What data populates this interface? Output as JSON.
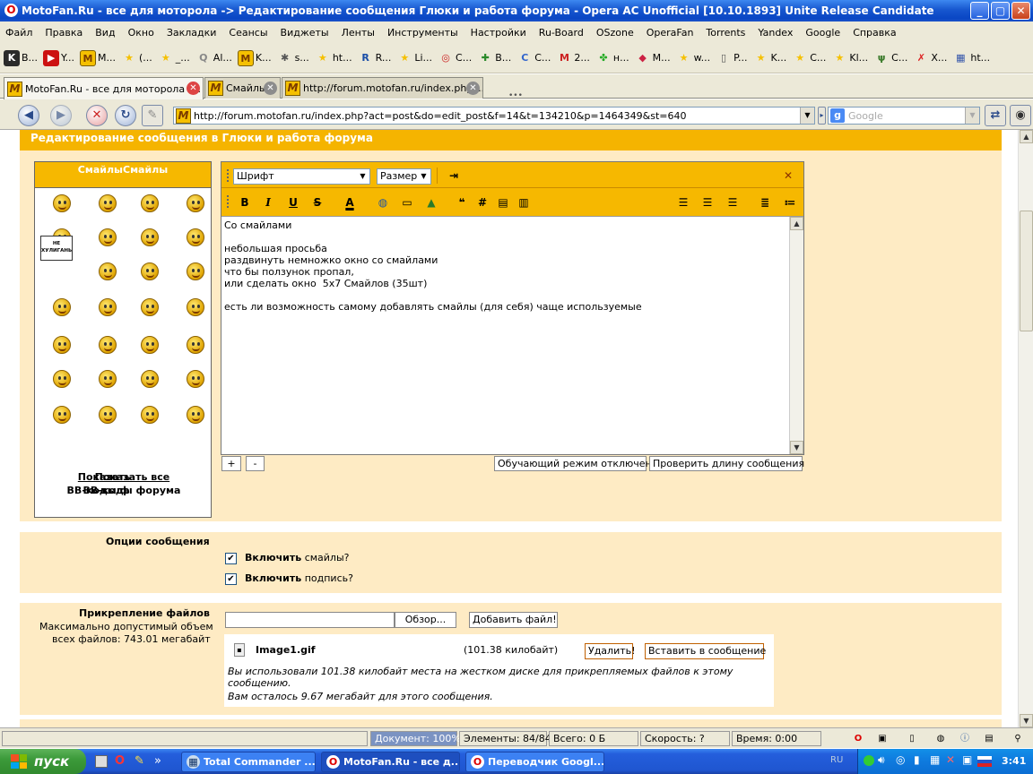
{
  "window": {
    "title": "MotoFan.Ru - все для моторола -> Редактирование сообщения Глюки и работа форума - Opera AC Unofficial [10.10.1893] Unite Release Candidate"
  },
  "menu": [
    "Файл",
    "Правка",
    "Вид",
    "Окно",
    "Закладки",
    "Сеансы",
    "Виджеты",
    "Ленты",
    "Инструменты",
    "Настройки",
    "Ru-Board",
    "OSzone",
    "OperaFan",
    "Torrents",
    "Yandex",
    "Google",
    "Справка"
  ],
  "bookmarks": [
    {
      "label": "B...",
      "icon": "knowyourmeme-icon",
      "color": "#2b2b2b"
    },
    {
      "label": "Y...",
      "icon": "youtube-icon",
      "color": "#cc1111"
    },
    {
      "label": "M...",
      "icon": "motofan-icon",
      "color": "#f5c000"
    },
    {
      "label": "(...",
      "icon": "star-icon",
      "color": "#f5c000"
    },
    {
      "label": "_...",
      "icon": "star-icon",
      "color": "#f5c000"
    },
    {
      "label": "Al...",
      "icon": "search-icon",
      "color": "#888888"
    },
    {
      "label": "K...",
      "icon": "motofan-icon",
      "color": "#f5c000"
    },
    {
      "label": "s...",
      "icon": "bug-icon",
      "color": "#555555"
    },
    {
      "label": "ht...",
      "icon": "star-icon",
      "color": "#f5c000"
    },
    {
      "label": "R...",
      "icon": "rm-icon",
      "color": "#1a4ea8"
    },
    {
      "label": "Li...",
      "icon": "star-icon",
      "color": "#f5c000"
    },
    {
      "label": "C...",
      "icon": "target-icon",
      "color": "#cc2222"
    },
    {
      "label": "B...",
      "icon": "cross-icon",
      "color": "#2a8a2a"
    },
    {
      "label": "C...",
      "icon": "c-icon",
      "color": "#3366cc"
    },
    {
      "label": "2...",
      "icon": "m-icon",
      "color": "#cc2222"
    },
    {
      "label": "н...",
      "icon": "clover-icon",
      "color": "#22aa22"
    },
    {
      "label": "M...",
      "icon": "gem-icon",
      "color": "#cc2244"
    },
    {
      "label": "w...",
      "icon": "star-icon",
      "color": "#f5c000"
    },
    {
      "label": "P...",
      "icon": "doc-icon",
      "color": "#555555"
    },
    {
      "label": "K...",
      "icon": "star-icon",
      "color": "#f5c000"
    },
    {
      "label": "C...",
      "icon": "star-icon",
      "color": "#f5c000"
    },
    {
      "label": "Kl...",
      "icon": "star-icon",
      "color": "#f5c000"
    },
    {
      "label": "C...",
      "icon": "grass-icon",
      "color": "#3a7a2a"
    },
    {
      "label": "X...",
      "icon": "x-icon",
      "color": "#dd2222"
    },
    {
      "label": "ht...",
      "icon": "grid-icon",
      "color": "#3355aa"
    }
  ],
  "tabs": [
    {
      "label": "MotoFan.Ru - все для моторола -..."
    },
    {
      "label": "Смайлы"
    },
    {
      "label": "http://forum.motofan.ru/index.php?..."
    }
  ],
  "nav": {
    "url": "http://forum.motofan.ru/index.php?act=post&do=edit_post&f=14&t=134210&p=1464349&st=640",
    "search_placeholder": "Google"
  },
  "page": {
    "header": "Редактирование сообщения в Глюки и работа форума",
    "smiles_header": "СмайлыСмайлы",
    "show_all": "Показать все",
    "show_all_prefix": "Показать",
    "bbcodes": "BB-коды форума",
    "bbcodes_prefix": "BB-коды ф",
    "no_hooligans": "НЕ ХУЛИГАНЬ",
    "font_select": "Шрифт",
    "size_select": "Размер",
    "editor_text": "Со смайлами\n\nнебольшая просьба\nраздвинуть немножко окно со смайлами\nчто бы ползунок пропал,\nили сделать окно  5x7 Смайлов (35шт)\n\nесть ли возможность самому добавлять смайлы (для себя) чаще используемые",
    "plus": "+",
    "minus": "-",
    "tutorial_mode": "Обучающий режим отключен",
    "check_length": "Проверить длину сообщения",
    "options_title": "Опции сообщения",
    "enable": "Включить",
    "enable_smiles": " смайлы?",
    "enable_signature": " подпись?",
    "attach_title": "Прикрепление файлов",
    "attach_max": "Максимально допустимый объем",
    "attach_total": "всех файлов: 743.01 мегабайт",
    "browse": "Обзор...",
    "add_file": "Добавить файл!",
    "file_name": "Image1.gif",
    "file_size": "(101.38 килобайт)",
    "delete": "Удалить!",
    "insert": "Вставить в сообщение",
    "used_note": "Вы использовали 101.38 килобайт места на жестком диске для прикрепляемых файлов к этому сообщению.",
    "left_note": "Вам осталось 9.67 мегабайт для этого сообщения."
  },
  "status": {
    "document": "Документ:  100%",
    "elements": "Элементы:   84/84",
    "total": "Всего:   0  Б",
    "speed": "Скорость:   ?",
    "time": "Время:   0:00"
  },
  "taskbar": {
    "start": "пуск",
    "tasks": [
      {
        "label": "Total Commander ..."
      },
      {
        "label": "MotoFan.Ru - все д..."
      },
      {
        "label": "Переводчик Googl..."
      }
    ],
    "lang": "RU",
    "clock": "3:41"
  }
}
